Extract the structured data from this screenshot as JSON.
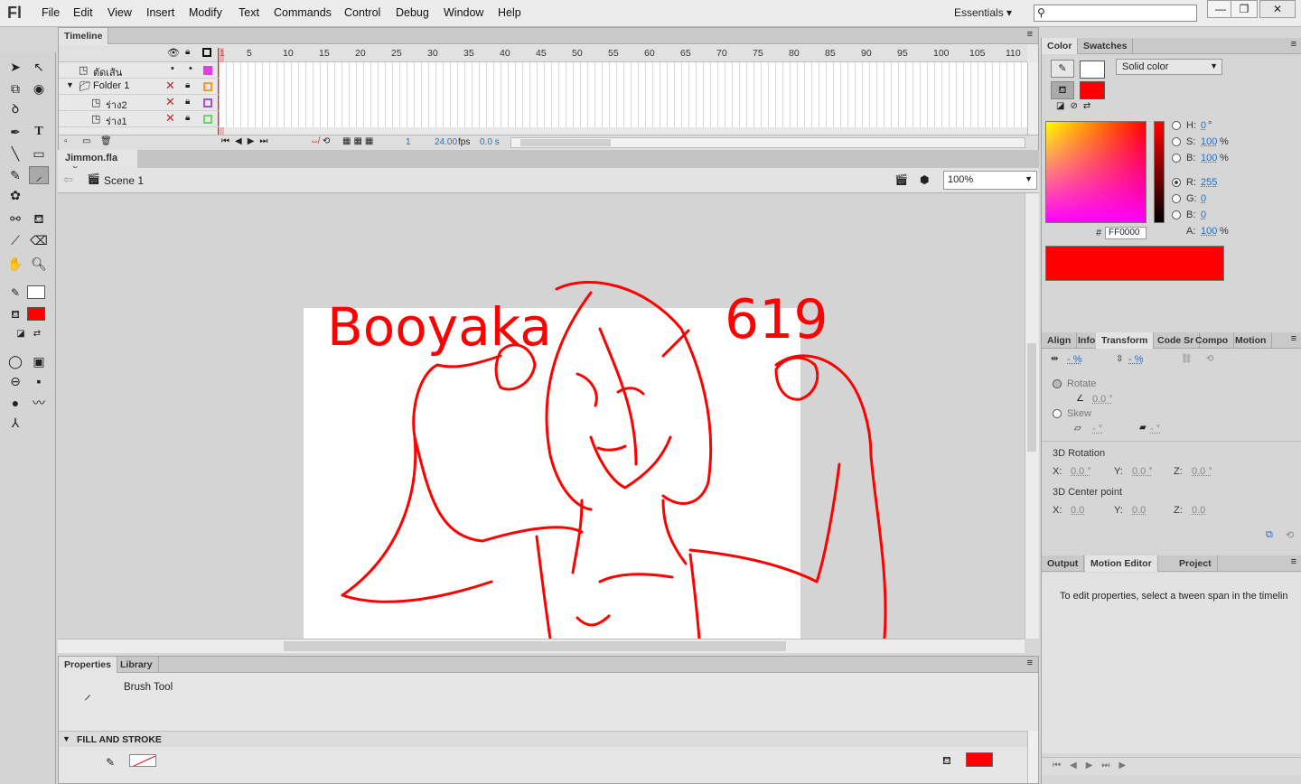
{
  "app": {
    "logo": "Fl"
  },
  "menu": [
    "File",
    "Edit",
    "View",
    "Insert",
    "Modify",
    "Text",
    "Commands",
    "Control",
    "Debug",
    "Window",
    "Help"
  ],
  "workspace": "Essentials",
  "timeline": {
    "tab": "Timeline",
    "frame_numbers": [
      "1",
      "5",
      "10",
      "15",
      "20",
      "25",
      "30",
      "35",
      "40",
      "45",
      "50",
      "55",
      "60",
      "65",
      "70",
      "75",
      "80",
      "85",
      "90",
      "95",
      "100",
      "105",
      "110"
    ],
    "layers": [
      {
        "name": "ตัดเส้น",
        "color": "#e23fe2"
      },
      {
        "name": "Folder 1",
        "color": "#f59a3a"
      },
      {
        "name": "ร่าง2",
        "color": "#a64ed6"
      },
      {
        "name": "ร่าง1",
        "color": "#6ad36a"
      }
    ],
    "current_frame": "1",
    "fps": "24.00",
    "fps_unit": "fps",
    "time": "0.0 s"
  },
  "document": {
    "tab": "Jimmon.fla",
    "scene": "Scene 1",
    "zoom": "100%"
  },
  "drawing_text": {
    "left": "Booyaka",
    "right": "619"
  },
  "properties": {
    "tabs": [
      "Properties",
      "Library"
    ],
    "tool_name": "Brush Tool",
    "section": "FILL AND STROKE",
    "fill_color": "#ff0000"
  },
  "color_panel": {
    "tabs": [
      "Color",
      "Swatches"
    ],
    "type": "Solid color",
    "stroke_color": "#ffffff",
    "fill_color": "#ff0000",
    "H_label": "H:",
    "H": "0",
    "H_unit": "°",
    "S_label": "S:",
    "S": "100",
    "S_unit": "%",
    "B_label": "B:",
    "B": "100",
    "B_unit": "%",
    "R_label": "R:",
    "R": "255",
    "G_label": "G:",
    "G": "0",
    "Bl_label": "B:",
    "Bl": "0",
    "A_label": "A:",
    "A": "100",
    "A_unit": "%",
    "hash": "#",
    "hex": "FF0000"
  },
  "transform_panel": {
    "tabs": [
      "Align",
      "Info",
      "Transform",
      "Code Sr",
      "Compo",
      "Motion"
    ],
    "width_pct": "- %",
    "height_pct": "- %",
    "rotate_label": "Rotate",
    "rotate_val": "0.0 °",
    "skew_label": "Skew",
    "skew_h": "- °",
    "skew_v": "- °",
    "rot3d_label": "3D Rotation",
    "x_label": "X:",
    "rot_x": "0.0 °",
    "y_label": "Y:",
    "rot_y": "0.0 °",
    "z_label": "Z:",
    "rot_z": "0.0 °",
    "center_label": "3D Center point",
    "cx": "0.0",
    "cy": "0.0",
    "cz": "0.0"
  },
  "bottom_panel": {
    "tabs": [
      "Output",
      "Motion Editor",
      "Project"
    ],
    "message": "To edit properties, select a tween span in the timelin"
  }
}
